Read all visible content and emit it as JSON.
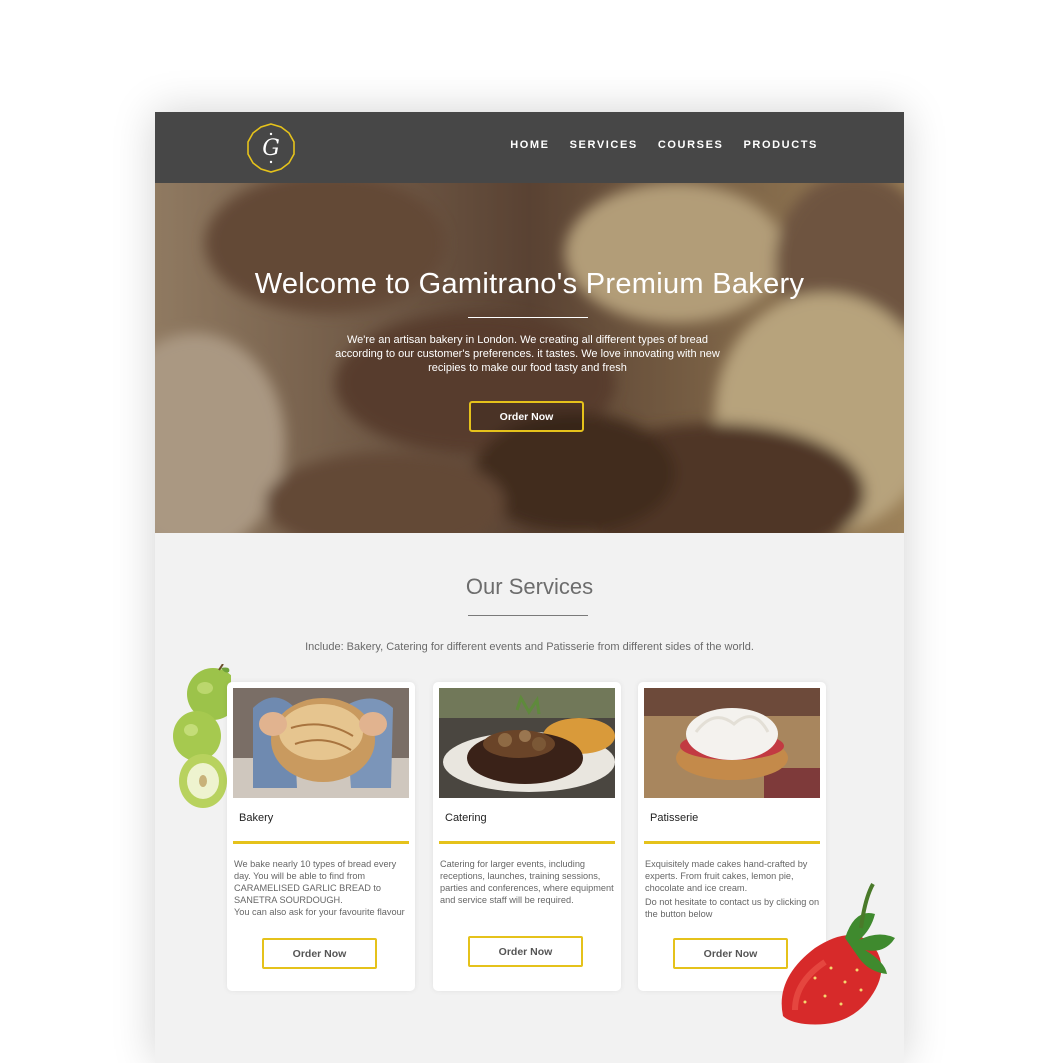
{
  "brand": {
    "logo_letter": "G",
    "logo_color": "#e5c21b"
  },
  "nav": [
    {
      "label": "HOME"
    },
    {
      "label": "SERVICES"
    },
    {
      "label": "COURSES"
    },
    {
      "label": "PRODUCTS"
    }
  ],
  "hero": {
    "title": "Welcome to Gamitrano's Premium Bakery",
    "text": "We're an artisan bakery in London. We creating all different types of bread according to our customer's preferences. it tastes. We love innovating with new recipies to make our food tasty and fresh",
    "button_label": "Order Now"
  },
  "services": {
    "title": "Our Services",
    "subtitle": "Include: Bakery, Catering for different events and Patisserie from different sides of the world.",
    "cards": [
      {
        "title": "Bakery",
        "text1": "We bake nearly 10 types of bread every day. You will be able to find from CARAMELISED GARLIC BREAD to SANETRA SOURDOUGH.",
        "text2": "You can also ask for your favourite flavour",
        "button_label": "Order Now"
      },
      {
        "title": "Catering",
        "text1": "Catering for larger events, including receptions, launches, training sessions, parties and conferences, where equipment and service staff will be required.",
        "text2": "",
        "button_label": "Order Now"
      },
      {
        "title": "Patisserie",
        "text1": "Exquisitely made cakes hand-crafted by experts. From fruit cakes, lemon pie, chocolate and ice cream.",
        "text2": "Do not hesitate to contact us by clicking on the button below",
        "button_label": "Order Now"
      }
    ]
  },
  "colors": {
    "accent": "#e5c21b",
    "header_bg": "#474747",
    "page_bg": "#f2f2f2"
  }
}
